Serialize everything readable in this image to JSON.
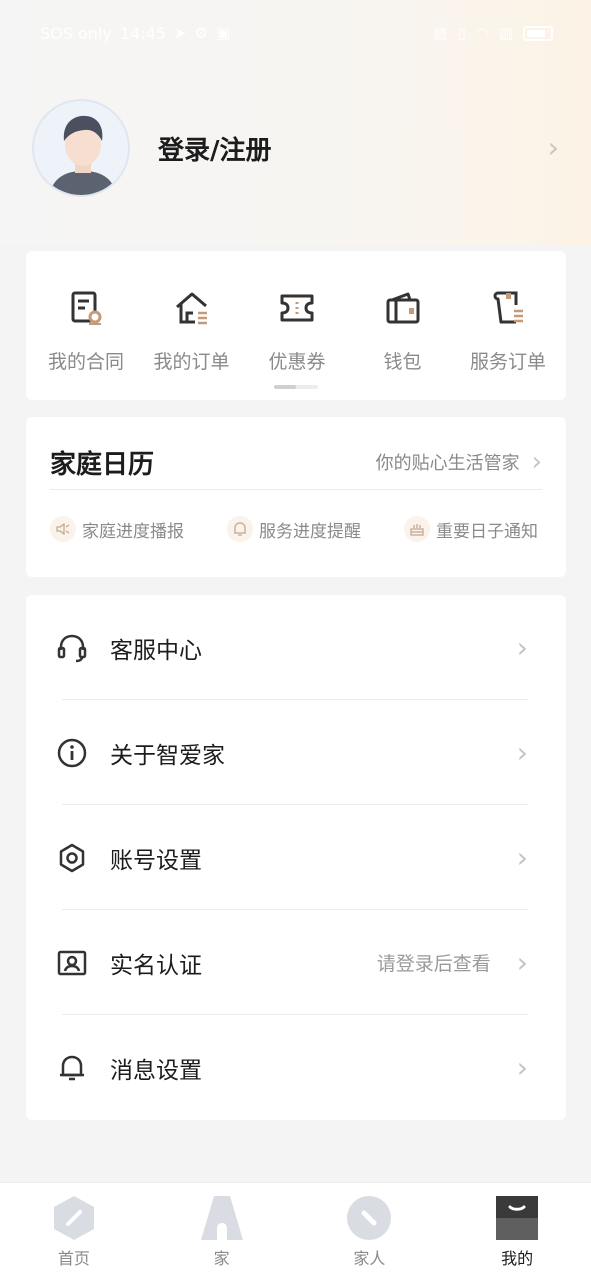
{
  "status_bar": {
    "carrier": "SOS only",
    "time": "14:45"
  },
  "profile": {
    "login_label": "登录/注册"
  },
  "quick_actions": [
    {
      "label": "我的合同",
      "icon": "contract-icon"
    },
    {
      "label": "我的订单",
      "icon": "house-order-icon"
    },
    {
      "label": "优惠券",
      "icon": "coupon-icon"
    },
    {
      "label": "钱包",
      "icon": "wallet-icon"
    },
    {
      "label": "服务订单",
      "icon": "service-order-icon"
    }
  ],
  "calendar": {
    "title": "家庭日历",
    "subtitle": "你的贴心生活管家",
    "tags": [
      {
        "label": "家庭进度播报",
        "icon": "speaker-icon"
      },
      {
        "label": "服务进度提醒",
        "icon": "bell-icon"
      },
      {
        "label": "重要日子通知",
        "icon": "cake-icon"
      }
    ]
  },
  "menu": [
    {
      "label": "客服中心",
      "icon": "headset-icon",
      "hint": ""
    },
    {
      "label": "关于智爱家",
      "icon": "info-icon",
      "hint": ""
    },
    {
      "label": "账号设置",
      "icon": "hexagon-settings-icon",
      "hint": ""
    },
    {
      "label": "实名认证",
      "icon": "id-card-icon",
      "hint": "请登录后查看"
    },
    {
      "label": "消息设置",
      "icon": "bell-icon",
      "hint": ""
    }
  ],
  "tabbar": [
    {
      "label": "首页",
      "icon": "home-hexagon-icon",
      "active": false
    },
    {
      "label": "家",
      "icon": "house-icon",
      "active": false
    },
    {
      "label": "家人",
      "icon": "family-icon",
      "active": false
    },
    {
      "label": "我的",
      "icon": "profile-icon",
      "active": true
    }
  ],
  "colors": {
    "accent_warm": "#c49a78",
    "icon_dark": "#333333",
    "text_muted": "#8a8a8a"
  }
}
